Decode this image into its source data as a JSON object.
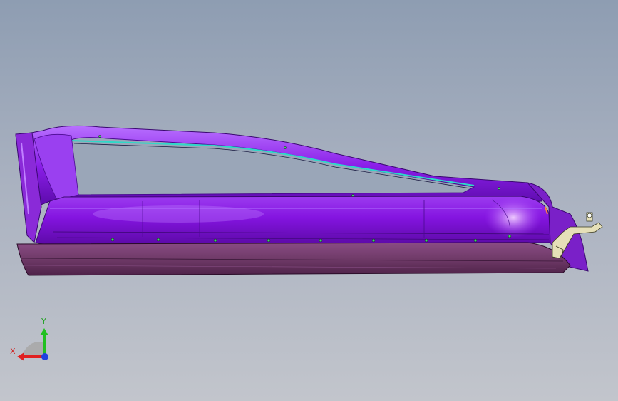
{
  "viewport": {
    "background_top": "#8e9db2",
    "background_bottom": "#c2c5cc"
  },
  "model": {
    "body_color": "#7a10d8",
    "highlight_color": "#d98cff",
    "sill_color": "#6f3a68",
    "glass_strip_color": "#2ed8c8",
    "bracket_color": "#e6e0b8"
  },
  "triad": {
    "x_label": "X",
    "y_label": "Y",
    "x_color": "#e02020",
    "y_color": "#20c020",
    "z_color": "#2040e0"
  }
}
